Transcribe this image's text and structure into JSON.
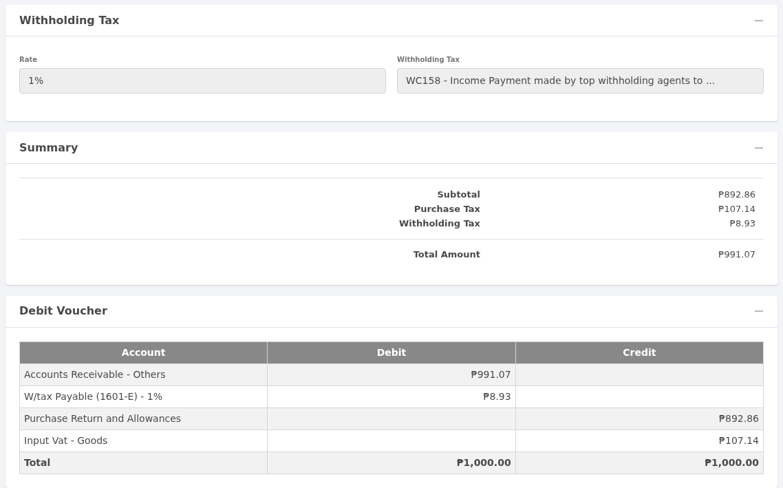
{
  "withholding_panel": {
    "title": "Withholding Tax",
    "expanded": true,
    "fields": [
      {
        "label": "Rate",
        "value": "1%"
      },
      {
        "label": "Withholding Tax",
        "value": "WC158 - Income Payment made by top withholding agents to ..."
      }
    ]
  },
  "summary_panel": {
    "title": "Summary",
    "expanded": true,
    "rows": [
      {
        "label": "Subtotal",
        "value": "₱892.86"
      },
      {
        "label": "Purchase Tax",
        "value": "₱107.14"
      },
      {
        "label": "Withholding Tax",
        "value": "₱8.93"
      }
    ],
    "total": {
      "label": "Total Amount",
      "value": "₱991.07"
    }
  },
  "voucher_panel": {
    "title": "Debit Voucher",
    "expanded": true,
    "table": {
      "columns": [
        "Account",
        "Debit",
        "Credit"
      ],
      "rows": [
        {
          "account": "Accounts Receivable - Others",
          "debit": "₱991.07",
          "credit": ""
        },
        {
          "account": "W/tax Payable (1601-E) - 1%",
          "debit": "₱8.93",
          "credit": ""
        },
        {
          "account": "Purchase Return and Allowances",
          "debit": "",
          "credit": "₱892.86"
        },
        {
          "account": "Input Vat - Goods",
          "debit": "",
          "credit": "₱107.14"
        }
      ],
      "total": {
        "account": "Total",
        "debit": "₱1,000.00",
        "credit": "₱1,000.00"
      }
    }
  }
}
